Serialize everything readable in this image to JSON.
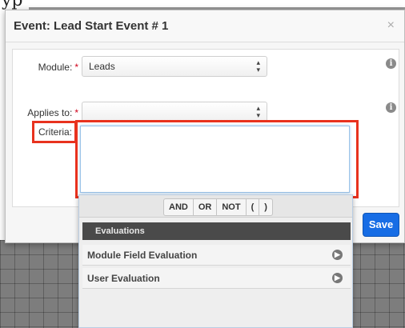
{
  "modal": {
    "title": "Event: Lead Start Event # 1",
    "close_icon": "×"
  },
  "form": {
    "module_label": "Module:",
    "module_value": "Leads",
    "applies_label": "Applies to:",
    "applies_value": "",
    "criteria_label": "Criteria:",
    "required_mark": "*",
    "info_icon": "i",
    "select_arrows": "▲▼"
  },
  "criteria_panel": {
    "logic_buttons": [
      "AND",
      "OR",
      "NOT",
      "(",
      ")"
    ],
    "section_title": "Evaluations",
    "items": [
      {
        "label": "Module Field Evaluation",
        "icon": "arrow-circle-right-icon"
      },
      {
        "label": "User Evaluation",
        "icon": "arrow-circle-right-icon"
      }
    ]
  },
  "actions": {
    "save_label": "Save"
  },
  "colors": {
    "accent": "#176de5",
    "highlight": "#e8321e",
    "required": "#d0021b"
  }
}
